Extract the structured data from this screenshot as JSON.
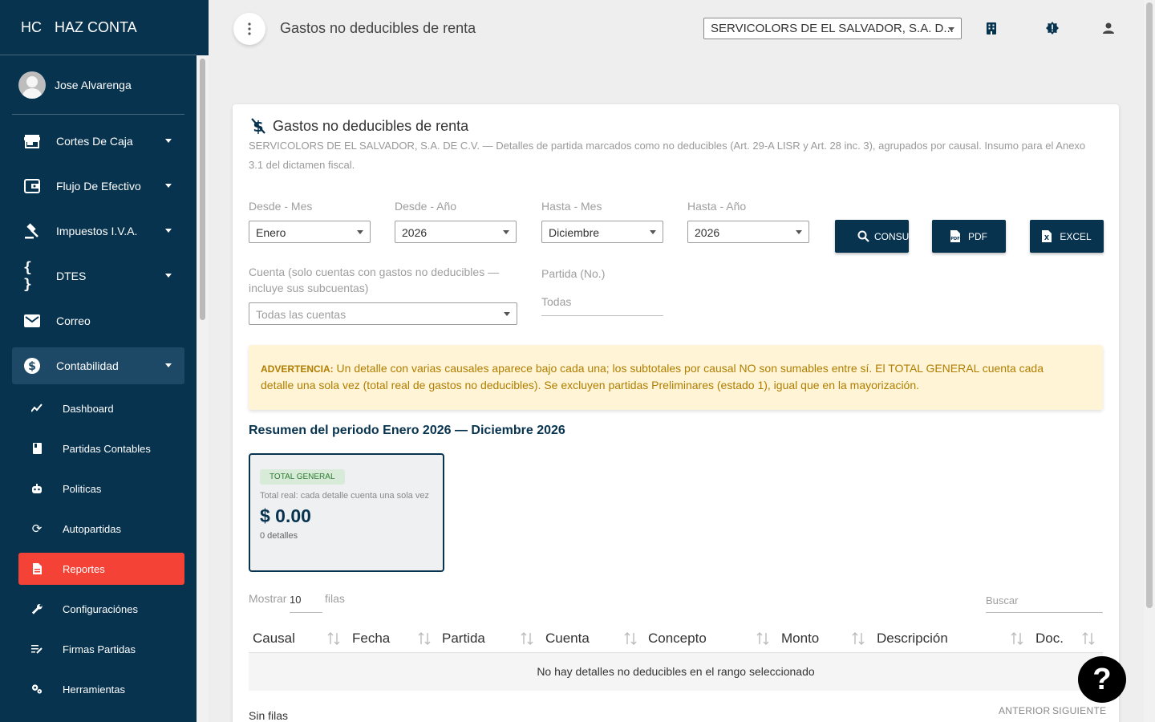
{
  "app": {
    "brand_short": "HC",
    "brand_name": "HAZ CONTA"
  },
  "user": {
    "name": "Jose Alvarenga"
  },
  "sidebar": {
    "items": [
      {
        "label": "Cortes De Caja",
        "icon": "store-icon"
      },
      {
        "label": "Flujo De Efectivo",
        "icon": "wallet-icon"
      },
      {
        "label": "Impuestos I.V.A.",
        "icon": "gavel-icon"
      },
      {
        "label": "DTES",
        "icon": "braces-icon"
      },
      {
        "label": "Correo",
        "icon": "mail-icon"
      },
      {
        "label": "Contabilidad",
        "icon": "dollar-circle-icon"
      }
    ],
    "subitems": [
      {
        "label": "Dashboard",
        "icon": "trending-icon"
      },
      {
        "label": "Partidas Contables",
        "icon": "book-icon"
      },
      {
        "label": "Politicas",
        "icon": "robot-icon"
      },
      {
        "label": "Autopartidas",
        "icon": "sync-icon"
      },
      {
        "label": "Reportes",
        "icon": "document-icon"
      },
      {
        "label": "Configuraciónes",
        "icon": "wrench-icon"
      },
      {
        "label": "Firmas Partidas",
        "icon": "signature-icon"
      },
      {
        "label": "Herramientas",
        "icon": "gears-icon"
      }
    ]
  },
  "header": {
    "title": "Gastos no deducibles de renta",
    "company_select": "SERVICOLORS DE EL SALVADOR, S.A. D..."
  },
  "card": {
    "title": "Gastos no deducibles de renta",
    "description": "SERVICOLORS DE EL SALVADOR, S.A. DE C.V. — Detalles de partida marcados como no deducibles (Art. 29-A LISR y Art. 28 inc. 3), agrupados por causal. Insumo para el Anexo 3.1 del dictamen fiscal."
  },
  "filters": {
    "desde_mes_label": "Desde - Mes",
    "desde_mes_value": "Enero",
    "desde_anio_label": "Desde - Año",
    "desde_anio_value": "2026",
    "hasta_mes_label": "Hasta - Mes",
    "hasta_mes_value": "Diciembre",
    "hasta_anio_label": "Hasta - Año",
    "hasta_anio_value": "2026",
    "cuenta_label": "Cuenta (solo cuentas con gastos no deducibles — incluye sus subcuentas)",
    "cuenta_value": "Todas las cuentas",
    "partida_label": "Partida (No.)",
    "partida_placeholder": "Todas"
  },
  "buttons": {
    "consultar": "CONSULTAR",
    "pdf": "PDF",
    "excel": "EXCEL"
  },
  "alert": {
    "prefix": "ADVERTENCIA:",
    "text": " Un detalle con varias causales aparece bajo cada una; los subtotales por causal NO son sumables entre sí. El TOTAL GENERAL cuenta cada detalle una sola vez (total real de gastos no deducibles). Se excluyen partidas Preliminares (estado 1), igual que en la mayorización."
  },
  "summary": {
    "title": "Resumen del periodo Enero 2026 — Diciembre 2026",
    "badge": "TOTAL GENERAL",
    "subtitle": "Total real: cada detalle cuenta una sola vez",
    "amount": "$ 0.00",
    "count": "0 detalles"
  },
  "table": {
    "show_label": "Mostrar",
    "show_value": "10",
    "rows_label": "filas",
    "search_placeholder": "Buscar",
    "columns": [
      "Causal",
      "Fecha",
      "Partida",
      "Cuenta",
      "Concepto",
      "Monto",
      "Descripción",
      "Doc."
    ],
    "empty_message": "No hay detalles no deducibles en el rango seleccionado",
    "footer_info": "Sin filas",
    "prev": "ANTERIOR",
    "next": "SIGUIENTE"
  },
  "help": {
    "label": "?"
  },
  "colors": {
    "primary": "#07334f",
    "active": "#f44336",
    "warning_bg": "#fff5d6",
    "warning_text": "#b07d00"
  }
}
